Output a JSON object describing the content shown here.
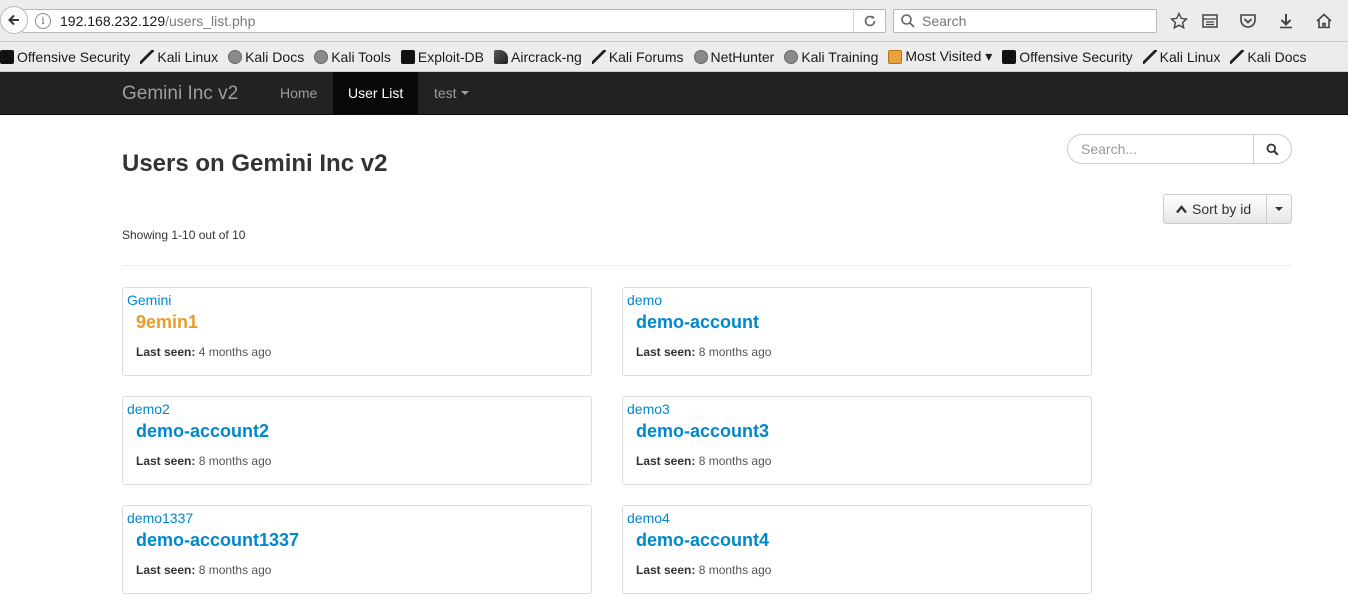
{
  "browser": {
    "url_host": "192.168.232.129",
    "url_path": "/users_list.php",
    "search_placeholder": "Search",
    "bookmarks": [
      {
        "label": "Offensive Security",
        "icon": "dragon"
      },
      {
        "label": "Kali Linux",
        "icon": "kali"
      },
      {
        "label": "Kali Docs",
        "icon": "globe"
      },
      {
        "label": "Kali Tools",
        "icon": "globe"
      },
      {
        "label": "Exploit-DB",
        "icon": "exploit"
      },
      {
        "label": "Aircrack-ng",
        "icon": "aircrack"
      },
      {
        "label": "Kali Forums",
        "icon": "kali"
      },
      {
        "label": "NetHunter",
        "icon": "globe"
      },
      {
        "label": "Kali Training",
        "icon": "globe"
      },
      {
        "label": "Most Visited ▾",
        "icon": "folder"
      },
      {
        "label": "Offensive Security",
        "icon": "dragon"
      },
      {
        "label": "Kali Linux",
        "icon": "kali"
      },
      {
        "label": "Kali Docs",
        "icon": "kali"
      }
    ]
  },
  "navbar": {
    "brand": "Gemini Inc v2",
    "home": "Home",
    "user_list": "User List",
    "user_menu": "test"
  },
  "main": {
    "title": "Users on Gemini Inc v2",
    "search_placeholder": "Search...",
    "sort_label": "Sort by id",
    "showing": "Showing 1-10 out of 10",
    "last_seen_label": "Last seen:",
    "users": [
      {
        "username": "Gemini",
        "display": "9emin1",
        "last_seen": "4 months ago",
        "accent": "#e89c2d"
      },
      {
        "username": "demo",
        "display": "demo-account",
        "last_seen": "8 months ago",
        "accent": "#0088cc"
      },
      {
        "username": "demo2",
        "display": "demo-account2",
        "last_seen": "8 months ago",
        "accent": "#0088cc"
      },
      {
        "username": "demo3",
        "display": "demo-account3",
        "last_seen": "8 months ago",
        "accent": "#0088cc"
      },
      {
        "username": "demo1337",
        "display": "demo-account1337",
        "last_seen": "8 months ago",
        "accent": "#0088cc"
      },
      {
        "username": "demo4",
        "display": "demo-account4",
        "last_seen": "8 months ago",
        "accent": "#0088cc"
      }
    ]
  },
  "colors": {
    "link": "#0088cc",
    "highlight": "#e89c2d",
    "navbar_bg": "#222222"
  }
}
